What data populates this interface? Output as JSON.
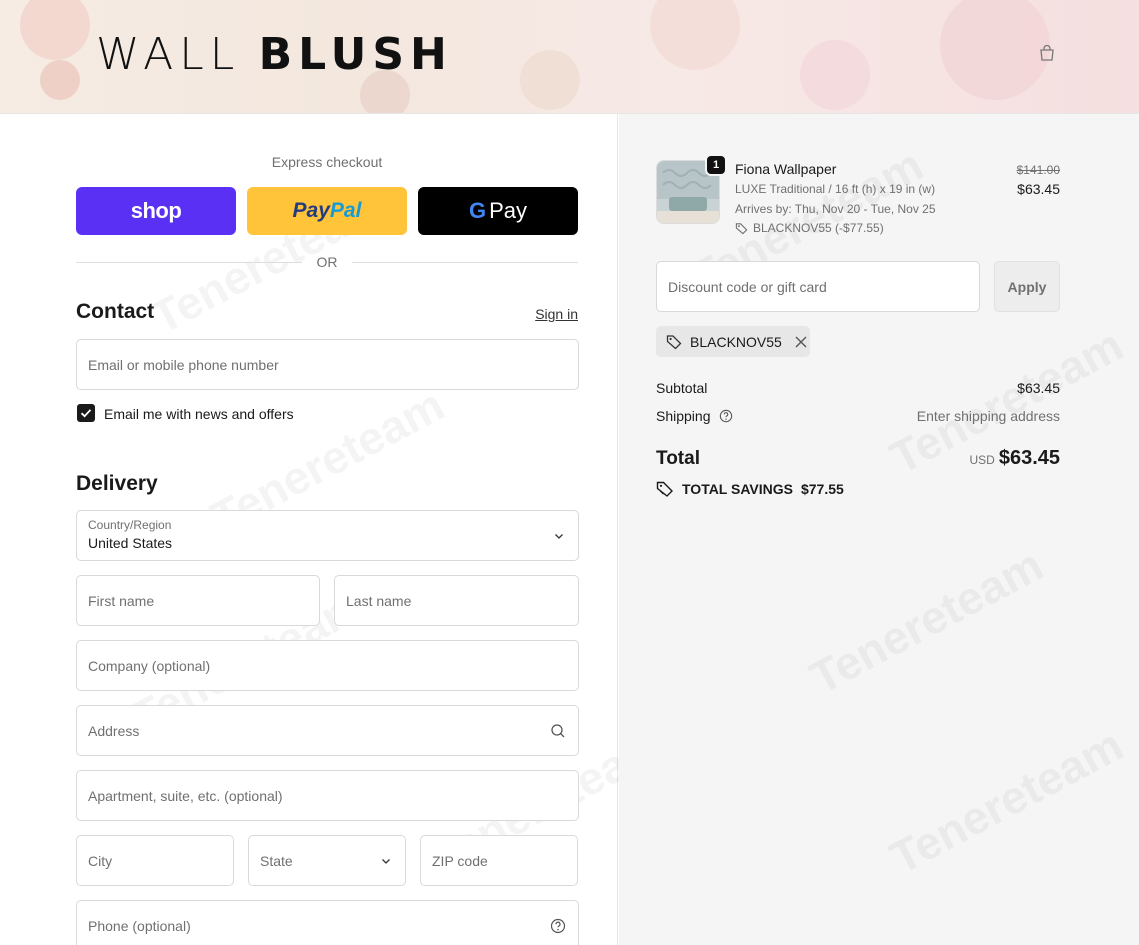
{
  "brand": {
    "logo_thin": "WALL",
    "logo_bold": "BLUSH"
  },
  "express": {
    "label": "Express checkout",
    "shop_label": "shop",
    "paypal_part1": "Pay",
    "paypal_part2": "Pal",
    "gpay_g": "G",
    "gpay_label": "Pay",
    "or_label": "OR"
  },
  "contact": {
    "title": "Contact",
    "signin": "Sign in",
    "email_placeholder": "Email or mobile phone number",
    "newsletter_label": "Email me with news and offers",
    "newsletter_checked": true
  },
  "delivery": {
    "title": "Delivery",
    "country_label": "Country/Region",
    "country_value": "United States",
    "first_name": "First name",
    "last_name": "Last name",
    "company": "Company (optional)",
    "address": "Address",
    "apartment": "Apartment, suite, etc. (optional)",
    "city": "City",
    "state": "State",
    "zip": "ZIP code",
    "phone": "Phone (optional)"
  },
  "order": {
    "quantity": "1",
    "product_name": "Fiona Wallpaper",
    "variant": "LUXE Traditional / 16 ft (h) x 19 in (w)",
    "arrives": "Arrives by: Thu, Nov 20 - Tue, Nov 25",
    "item_discount": "BLACKNOV55 (-$77.55)",
    "original_price": "$141.00",
    "price": "$63.45",
    "discount_placeholder": "Discount code or gift card",
    "apply_label": "Apply",
    "applied_code": "BLACKNOV55",
    "subtotal_label": "Subtotal",
    "subtotal_value": "$63.45",
    "shipping_label": "Shipping",
    "shipping_value": "Enter shipping address",
    "total_label": "Total",
    "currency": "USD",
    "total_value": "$63.45",
    "savings_label": "TOTAL SAVINGS",
    "savings_value": "$77.55"
  },
  "colors": {
    "shop": "#5a31f4",
    "paypal": "#ffc439",
    "gpay": "#000000",
    "summary_bg": "#f5f5f5"
  },
  "icons": [
    "bag-icon",
    "chevron-down-icon",
    "search-icon",
    "help-circle-icon",
    "tag-icon",
    "close-icon",
    "check-icon",
    "google-g-icon"
  ]
}
